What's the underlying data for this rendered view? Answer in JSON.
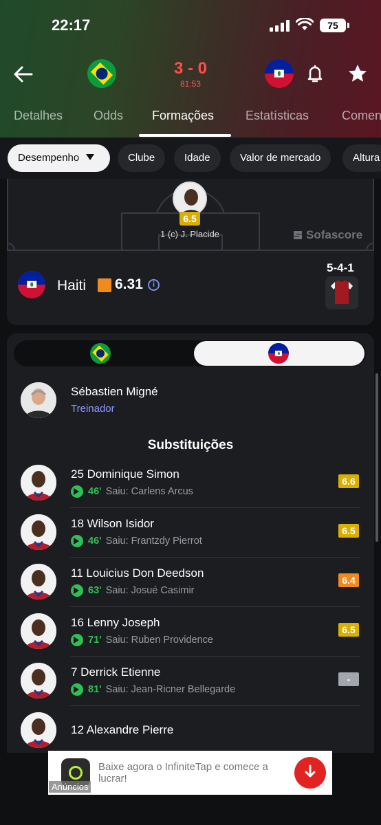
{
  "status_bar": {
    "time": "22:17",
    "battery": "75"
  },
  "match": {
    "score": "3 - 0",
    "clock": "81:53",
    "home_flag": "brazil-flag",
    "away_flag": "haiti-flag"
  },
  "tabs": [
    {
      "label": "Detalhes",
      "active": false
    },
    {
      "label": "Odds",
      "active": false
    },
    {
      "label": "Formações",
      "active": true
    },
    {
      "label": "Estatísticas",
      "active": false
    },
    {
      "label": "Comen",
      "active": false
    }
  ],
  "filters": [
    "Desempenho",
    "Clube",
    "Idade",
    "Valor de mercado",
    "Altura"
  ],
  "pitch": {
    "goalkeeper": {
      "rating": "6.5",
      "label": "1 (c) J. Placide"
    },
    "watermark": "Sofascore"
  },
  "team": {
    "name": "Haiti",
    "rating": "6.31",
    "formation": "5-4-1"
  },
  "coach": {
    "name": "Sébastien Migné",
    "role": "Treinador"
  },
  "subs_title": "Substituições",
  "substitutions": [
    {
      "name": "25 Dominique Simon",
      "minute": "46'",
      "out": "Saiu: Carlens Arcus",
      "rating": "6.6",
      "rating_color": "#d9b000"
    },
    {
      "name": "18 Wilson Isidor",
      "minute": "46'",
      "out": "Saiu: Frantzdy Pierrot",
      "rating": "6.5",
      "rating_color": "#d9b000"
    },
    {
      "name": "11 Louicius Don Deedson",
      "minute": "63'",
      "out": "Saiu: Josué Casimir",
      "rating": "6.4",
      "rating_color": "#f08a1c"
    },
    {
      "name": "16 Lenny Joseph",
      "minute": "71'",
      "out": "Saiu: Ruben Providence",
      "rating": "6.5",
      "rating_color": "#d9b000"
    },
    {
      "name": "7 Derrick Etienne",
      "minute": "81'",
      "out": "Saiu: Jean-Ricner Bellegarde",
      "rating": "-",
      "rating_color": "#a3a6ad"
    },
    {
      "name": "12 Alexandre Pierre"
    }
  ],
  "ad": {
    "text": "Baixe agora o InfiniteTap e comece a lucrar!",
    "label": "Anúncios"
  },
  "colors": {
    "accent_link": "#8b9cff",
    "sub_green": "#2fbf55",
    "score_red": "#ff4d4d"
  }
}
